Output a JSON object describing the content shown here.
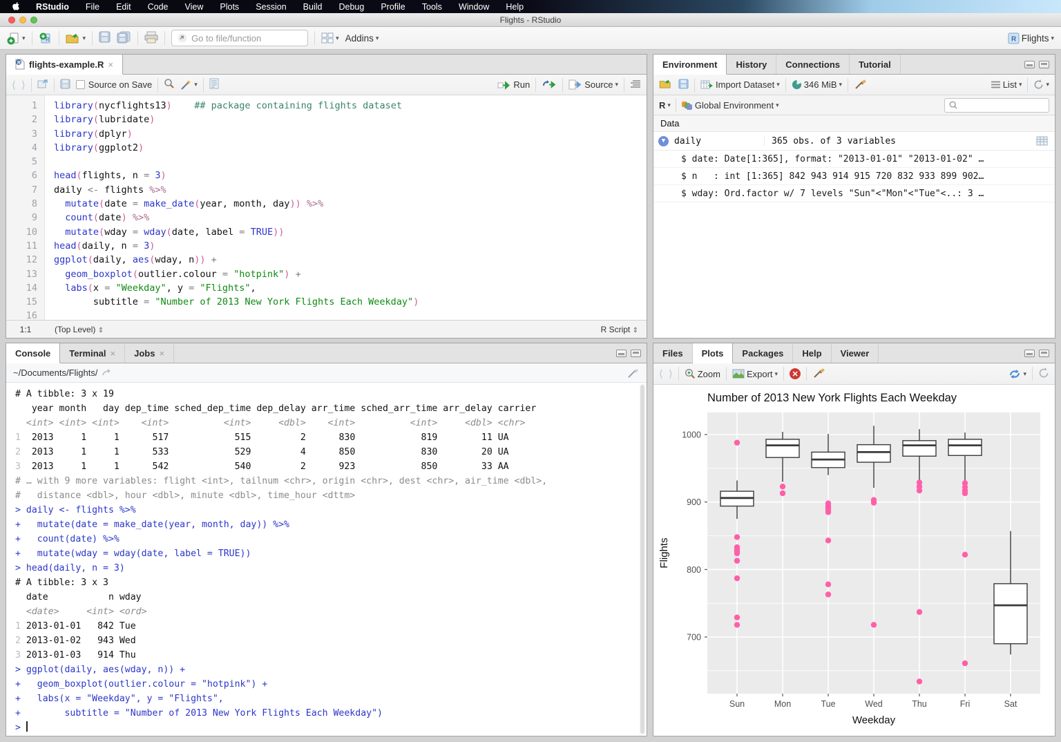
{
  "menubar": {
    "items": [
      "RStudio",
      "File",
      "Edit",
      "Code",
      "View",
      "Plots",
      "Session",
      "Build",
      "Debug",
      "Profile",
      "Tools",
      "Window",
      "Help"
    ]
  },
  "titlebar": {
    "title": "Flights - RStudio"
  },
  "toolbar": {
    "goto_placeholder": "Go to file/function",
    "addins_label": "Addins",
    "project_label": "Flights"
  },
  "icons": {
    "dropdown": "▾",
    "updown": "⇕",
    "close": "×",
    "back": "⟨",
    "forward": "⟩"
  },
  "source_pane": {
    "tab_label": "flights-example.R",
    "source_on_save_label": "Source on Save",
    "run_label": "Run",
    "source_label": "Source",
    "status_position": "1:1",
    "status_scope": "(Top Level)",
    "status_type": "R Script",
    "line_count": 16,
    "code_lines": [
      [
        [
          "fn",
          "library"
        ],
        [
          "p",
          "("
        ],
        [
          "id",
          "nycflights13"
        ],
        [
          "p",
          ")"
        ],
        [
          "id",
          "    "
        ],
        [
          "cm",
          "## package containing flights dataset"
        ]
      ],
      [
        [
          "fn",
          "library"
        ],
        [
          "p",
          "("
        ],
        [
          "id",
          "lubridate"
        ],
        [
          "p",
          ")"
        ]
      ],
      [
        [
          "fn",
          "library"
        ],
        [
          "p",
          "("
        ],
        [
          "id",
          "dplyr"
        ],
        [
          "p",
          ")"
        ]
      ],
      [
        [
          "fn",
          "library"
        ],
        [
          "p",
          "("
        ],
        [
          "id",
          "ggplot2"
        ],
        [
          "p",
          ")"
        ]
      ],
      [],
      [
        [
          "fn",
          "head"
        ],
        [
          "p",
          "("
        ],
        [
          "id",
          "flights, n "
        ],
        [
          "op",
          "= "
        ],
        [
          "num",
          "3"
        ],
        [
          "p",
          ")"
        ]
      ],
      [
        [
          "id",
          "daily "
        ],
        [
          "op",
          "<- "
        ],
        [
          "id",
          "flights "
        ],
        [
          "pi",
          "%>%"
        ]
      ],
      [
        [
          "id",
          "  "
        ],
        [
          "fn",
          "mutate"
        ],
        [
          "p",
          "("
        ],
        [
          "id",
          "date "
        ],
        [
          "op",
          "= "
        ],
        [
          "fn",
          "make_date"
        ],
        [
          "p",
          "("
        ],
        [
          "id",
          "year, month, day"
        ],
        [
          "p",
          "))"
        ],
        [
          "pi",
          " %>%"
        ]
      ],
      [
        [
          "id",
          "  "
        ],
        [
          "fn",
          "count"
        ],
        [
          "p",
          "("
        ],
        [
          "id",
          "date"
        ],
        [
          "p",
          ")"
        ],
        [
          "pi",
          " %>%"
        ]
      ],
      [
        [
          "id",
          "  "
        ],
        [
          "fn",
          "mutate"
        ],
        [
          "p",
          "("
        ],
        [
          "id",
          "wday "
        ],
        [
          "op",
          "= "
        ],
        [
          "fn",
          "wday"
        ],
        [
          "p",
          "("
        ],
        [
          "id",
          "date, label "
        ],
        [
          "op",
          "= "
        ],
        [
          "num",
          "TRUE"
        ],
        [
          "p",
          "))"
        ]
      ],
      [
        [
          "fn",
          "head"
        ],
        [
          "p",
          "("
        ],
        [
          "id",
          "daily, n "
        ],
        [
          "op",
          "= "
        ],
        [
          "num",
          "3"
        ],
        [
          "p",
          ")"
        ]
      ],
      [
        [
          "fn",
          "ggplot"
        ],
        [
          "p",
          "("
        ],
        [
          "id",
          "daily, "
        ],
        [
          "fn",
          "aes"
        ],
        [
          "p",
          "("
        ],
        [
          "id",
          "wday, n"
        ],
        [
          "p",
          "))"
        ],
        [
          "op",
          " +"
        ]
      ],
      [
        [
          "id",
          "  "
        ],
        [
          "fn",
          "geom_boxplot"
        ],
        [
          "p",
          "("
        ],
        [
          "id",
          "outlier.colour "
        ],
        [
          "op",
          "= "
        ],
        [
          "str",
          "\"hotpink\""
        ],
        [
          "p",
          ")"
        ],
        [
          "op",
          " +"
        ]
      ],
      [
        [
          "id",
          "  "
        ],
        [
          "fn",
          "labs"
        ],
        [
          "p",
          "("
        ],
        [
          "id",
          "x "
        ],
        [
          "op",
          "= "
        ],
        [
          "str",
          "\"Weekday\""
        ],
        [
          "id",
          ", y "
        ],
        [
          "op",
          "= "
        ],
        [
          "str",
          "\"Flights\""
        ],
        [
          "id",
          ","
        ]
      ],
      [
        [
          "id",
          "       subtitle "
        ],
        [
          "op",
          "= "
        ],
        [
          "str",
          "\"Number of 2013 New York Flights Each Weekday\""
        ],
        [
          "p",
          ")"
        ]
      ],
      []
    ]
  },
  "console_pane": {
    "tabs": [
      {
        "label": "Console",
        "active": true,
        "closable": false
      },
      {
        "label": "Terminal",
        "active": false,
        "closable": true
      },
      {
        "label": "Jobs",
        "active": false,
        "closable": true
      }
    ],
    "path": "~/Documents/Flights/",
    "lines": [
      [
        [
          "out",
          "# A tibble: 3 x 19"
        ]
      ],
      [
        [
          "out",
          "   year month   day dep_time sched_dep_time dep_delay arr_time sched_arr_time arr_delay carrier"
        ]
      ],
      [
        [
          "typ",
          "  <int> <int> <int>    <int>          <int>     <dbl>    <int>          <int>     <dbl> <chr>  "
        ]
      ],
      [
        [
          "rn",
          "1"
        ],
        [
          "out",
          "  2013     1     1      517            515         2      830            819        11 UA     "
        ]
      ],
      [
        [
          "rn",
          "2"
        ],
        [
          "out",
          "  2013     1     1      533            529         4      850            830        20 UA     "
        ]
      ],
      [
        [
          "rn",
          "3"
        ],
        [
          "out",
          "  2013     1     1      542            540         2      923            850        33 AA     "
        ]
      ],
      [
        [
          "dim",
          "# … with 9 more variables: flight <int>, tailnum <chr>, origin <chr>, dest <chr>, air_time <dbl>,"
        ]
      ],
      [
        [
          "dim",
          "#   distance <dbl>, hour <dbl>, minute <dbl>, time_hour <dttm>"
        ]
      ],
      [
        [
          "in",
          "> daily <- flights %>%"
        ]
      ],
      [
        [
          "in",
          "+   mutate(date = make_date(year, month, day)) %>%"
        ]
      ],
      [
        [
          "in",
          "+   count(date) %>%"
        ]
      ],
      [
        [
          "in",
          "+   mutate(wday = wday(date, label = TRUE))"
        ]
      ],
      [
        [
          "in",
          "> head(daily, n = 3)"
        ]
      ],
      [
        [
          "out",
          "# A tibble: 3 x 3"
        ]
      ],
      [
        [
          "out",
          "  date           n wday "
        ]
      ],
      [
        [
          "typ",
          "  <date>     <int> <ord>"
        ]
      ],
      [
        [
          "rn",
          "1"
        ],
        [
          "out",
          " 2013-01-01   842 Tue  "
        ]
      ],
      [
        [
          "rn",
          "2"
        ],
        [
          "out",
          " 2013-01-02   943 Wed  "
        ]
      ],
      [
        [
          "rn",
          "3"
        ],
        [
          "out",
          " 2013-01-03   914 Thu  "
        ]
      ],
      [
        [
          "in",
          "> ggplot(daily, aes(wday, n)) +"
        ]
      ],
      [
        [
          "in",
          "+   geom_boxplot(outlier.colour = \"hotpink\") +"
        ]
      ],
      [
        [
          "in",
          "+   labs(x = \"Weekday\", y = \"Flights\","
        ]
      ],
      [
        [
          "in",
          "+        subtitle = \"Number of 2013 New York Flights Each Weekday\")"
        ]
      ],
      [
        [
          "in",
          "> "
        ],
        [
          "cur",
          ""
        ]
      ]
    ]
  },
  "environment_pane": {
    "tabs": [
      {
        "label": "Environment",
        "active": true
      },
      {
        "label": "History",
        "active": false
      },
      {
        "label": "Connections",
        "active": false
      },
      {
        "label": "Tutorial",
        "active": false
      }
    ],
    "toolbar": {
      "import_label": "Import Dataset",
      "memory_label": "346 MiB",
      "list_label": "List"
    },
    "env_row": {
      "r_label": "R",
      "env_label": "Global Environment"
    },
    "search_placeholder": "",
    "data_header": "Data",
    "object": {
      "name": "daily",
      "summary": "365 obs. of 3 variables"
    },
    "fields": [
      "$ date: Date[1:365], format: \"2013-01-01\" \"2013-01-02\" …",
      "$ n   : int [1:365] 842 943 914 915 720 832 933 899 902…",
      "$ wday: Ord.factor w/ 7 levels \"Sun\"<\"Mon\"<\"Tue\"<..: 3 …"
    ]
  },
  "plots_pane": {
    "tabs": [
      {
        "label": "Files",
        "active": false
      },
      {
        "label": "Plots",
        "active": true
      },
      {
        "label": "Packages",
        "active": false
      },
      {
        "label": "Help",
        "active": false
      },
      {
        "label": "Viewer",
        "active": false
      }
    ],
    "toolbar": {
      "zoom_label": "Zoom",
      "export_label": "Export"
    }
  },
  "chart_data": {
    "type": "boxplot",
    "title": "Number of 2013 New York Flights Each Weekday",
    "xlabel": "Weekday",
    "ylabel": "Flights",
    "categories": [
      "Sun",
      "Mon",
      "Tue",
      "Wed",
      "Thu",
      "Fri",
      "Sat"
    ],
    "ylim": [
      615,
      1033
    ],
    "yticks": [
      700,
      800,
      900,
      1000
    ],
    "yticks_minor": [
      650,
      750,
      850,
      950
    ],
    "grid": true,
    "panel_bg": "#EBEBEB",
    "grid_color": "#FFFFFF",
    "box_color": "#3A3A3A",
    "outlier_color": "#FF5FA9",
    "series": [
      {
        "category": "Sun",
        "whisker_low": 875,
        "q1": 894,
        "median": 906,
        "q3": 916,
        "whisker_high": 932,
        "outliers": [
          988,
          848,
          833,
          830,
          827,
          824,
          813,
          787,
          729,
          718
        ]
      },
      {
        "category": "Mon",
        "whisker_low": 930,
        "q1": 966,
        "median": 984,
        "q3": 993,
        "whisker_high": 1004,
        "outliers": [
          923,
          913
        ]
      },
      {
        "category": "Tue",
        "whisker_low": 940,
        "q1": 951,
        "median": 963,
        "q3": 974,
        "whisker_high": 1001,
        "outliers": [
          898,
          894,
          891,
          888,
          885,
          843,
          778,
          763
        ]
      },
      {
        "category": "Wed",
        "whisker_low": 921,
        "q1": 959,
        "median": 974,
        "q3": 985,
        "whisker_high": 1013,
        "outliers": [
          903,
          899,
          718
        ]
      },
      {
        "category": "Thu",
        "whisker_low": 932,
        "q1": 968,
        "median": 984,
        "q3": 991,
        "whisker_high": 1008,
        "outliers": [
          929,
          923,
          917,
          737,
          634
        ]
      },
      {
        "category": "Fri",
        "whisker_low": 916,
        "q1": 969,
        "median": 984,
        "q3": 993,
        "whisker_high": 1003,
        "outliers": [
          928,
          922,
          917,
          913,
          822,
          661
        ]
      },
      {
        "category": "Sat",
        "whisker_low": 674,
        "q1": 690,
        "median": 747,
        "q3": 779,
        "whisker_high": 857,
        "outliers": []
      }
    ]
  }
}
